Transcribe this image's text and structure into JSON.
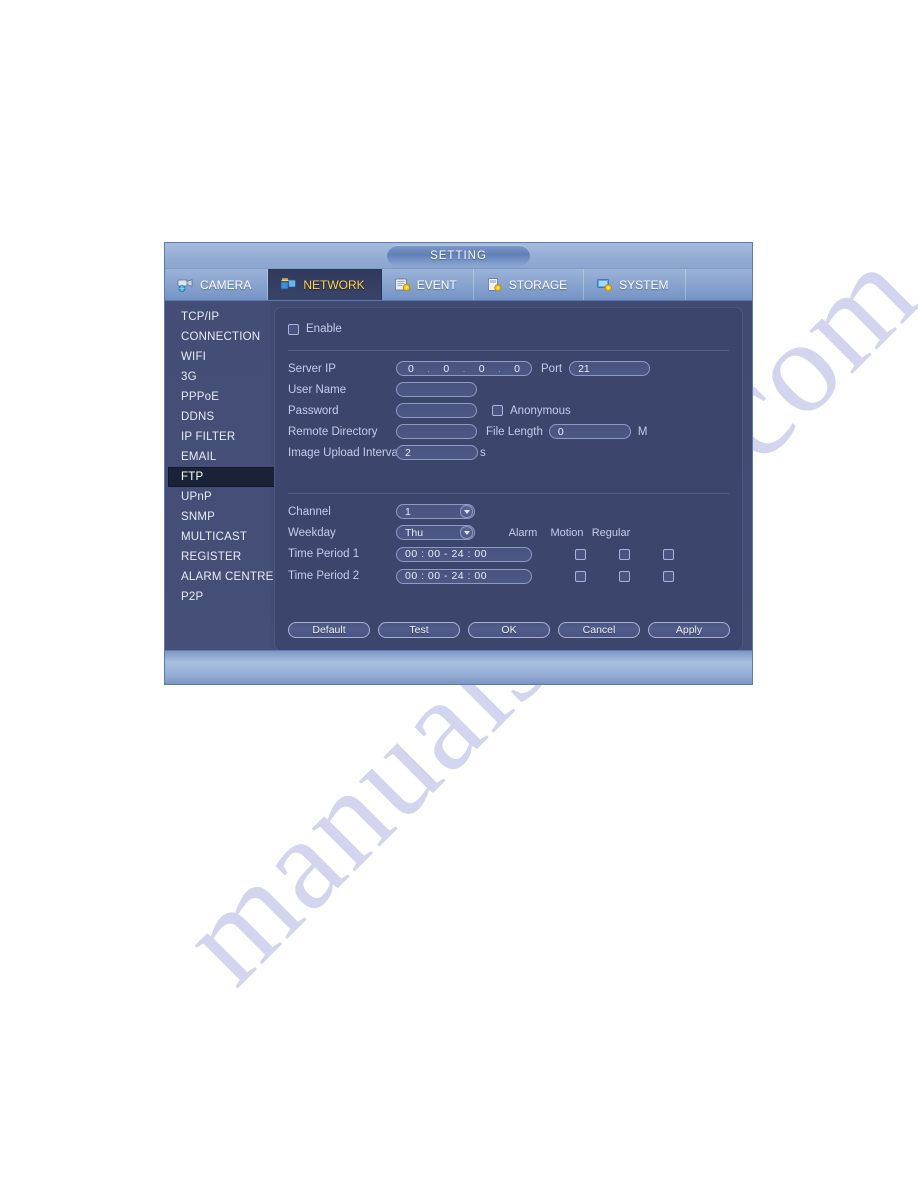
{
  "window": {
    "title": "SETTING"
  },
  "tabs": [
    {
      "label": "CAMERA",
      "icon": "camera-icon",
      "active": false
    },
    {
      "label": "NETWORK",
      "icon": "network-icon",
      "active": true
    },
    {
      "label": "EVENT",
      "icon": "event-icon",
      "active": false
    },
    {
      "label": "STORAGE",
      "icon": "storage-icon",
      "active": false
    },
    {
      "label": "SYSTEM",
      "icon": "system-icon",
      "active": false
    }
  ],
  "sidebar": {
    "items": [
      {
        "label": "TCP/IP",
        "selected": false
      },
      {
        "label": "CONNECTION",
        "selected": false
      },
      {
        "label": "WIFI",
        "selected": false
      },
      {
        "label": "3G",
        "selected": false
      },
      {
        "label": "PPPoE",
        "selected": false
      },
      {
        "label": "DDNS",
        "selected": false
      },
      {
        "label": "IP FILTER",
        "selected": false
      },
      {
        "label": "EMAIL",
        "selected": false
      },
      {
        "label": "FTP",
        "selected": true
      },
      {
        "label": "UPnP",
        "selected": false
      },
      {
        "label": "SNMP",
        "selected": false
      },
      {
        "label": "MULTICAST",
        "selected": false
      },
      {
        "label": "REGISTER",
        "selected": false
      },
      {
        "label": "ALARM CENTRE",
        "selected": false
      },
      {
        "label": "P2P",
        "selected": false
      }
    ]
  },
  "form": {
    "enable": {
      "label": "Enable",
      "checked": false
    },
    "server_ip": {
      "label": "Server IP",
      "octets": [
        "0",
        "0",
        "0",
        "0"
      ],
      "separator": "."
    },
    "port": {
      "label": "Port",
      "value": "21"
    },
    "user_name": {
      "label": "User Name",
      "value": ""
    },
    "password": {
      "label": "Password",
      "value": ""
    },
    "anonymous": {
      "label": "Anonymous",
      "checked": false
    },
    "remote_directory": {
      "label": "Remote Directory",
      "value": ""
    },
    "file_length": {
      "label": "File Length",
      "value": "0",
      "unit": "M"
    },
    "image_upload_interval": {
      "label": "Image Upload Interval",
      "value": "2",
      "unit": "s"
    },
    "channel": {
      "label": "Channel",
      "value": "1"
    },
    "weekday": {
      "label": "Weekday",
      "value": "Thu"
    },
    "columns": [
      "Alarm",
      "Motion",
      "Regular"
    ],
    "time_periods": [
      {
        "label": "Time Period 1",
        "value": "00 : 00      - 24 : 00",
        "alarm": false,
        "motion": false,
        "regular": false
      },
      {
        "label": "Time Period 2",
        "value": "00 : 00      - 24 : 00",
        "alarm": false,
        "motion": false,
        "regular": false
      }
    ]
  },
  "buttons": {
    "default": "Default",
    "test": "Test",
    "ok": "OK",
    "cancel": "Cancel",
    "apply": "Apply"
  },
  "watermark": {
    "text": "manualshlife.com"
  },
  "colors": {
    "dialog_chrome": "#8aa6cf",
    "panel_bg": "#3c456c",
    "sidebar_bg": "#454f77",
    "selected_item_bg": "#1a2238",
    "active_tab_text": "#ffd34d",
    "label_text": "#c4cdec",
    "field_border": "#8f9ac4"
  }
}
